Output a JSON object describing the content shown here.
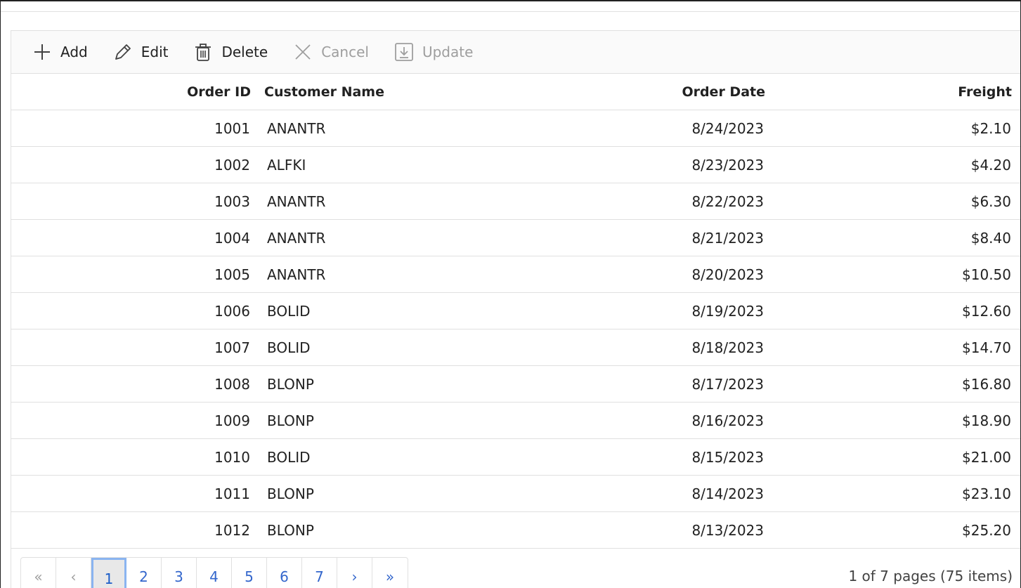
{
  "toolbar": {
    "add": "Add",
    "edit": "Edit",
    "delete": "Delete",
    "cancel": "Cancel",
    "update": "Update"
  },
  "columns": {
    "order_id": "Order ID",
    "customer_name": "Customer Name",
    "order_date": "Order Date",
    "freight": "Freight"
  },
  "rows": [
    {
      "order_id": "1001",
      "customer_name": "ANANTR",
      "order_date": "8/24/2023",
      "freight": "$2.10"
    },
    {
      "order_id": "1002",
      "customer_name": "ALFKI",
      "order_date": "8/23/2023",
      "freight": "$4.20"
    },
    {
      "order_id": "1003",
      "customer_name": "ANANTR",
      "order_date": "8/22/2023",
      "freight": "$6.30"
    },
    {
      "order_id": "1004",
      "customer_name": "ANANTR",
      "order_date": "8/21/2023",
      "freight": "$8.40"
    },
    {
      "order_id": "1005",
      "customer_name": "ANANTR",
      "order_date": "8/20/2023",
      "freight": "$10.50"
    },
    {
      "order_id": "1006",
      "customer_name": "BOLID",
      "order_date": "8/19/2023",
      "freight": "$12.60"
    },
    {
      "order_id": "1007",
      "customer_name": "BOLID",
      "order_date": "8/18/2023",
      "freight": "$14.70"
    },
    {
      "order_id": "1008",
      "customer_name": "BLONP",
      "order_date": "8/17/2023",
      "freight": "$16.80"
    },
    {
      "order_id": "1009",
      "customer_name": "BLONP",
      "order_date": "8/16/2023",
      "freight": "$18.90"
    },
    {
      "order_id": "1010",
      "customer_name": "BOLID",
      "order_date": "8/15/2023",
      "freight": "$21.00"
    },
    {
      "order_id": "1011",
      "customer_name": "BLONP",
      "order_date": "8/14/2023",
      "freight": "$23.10"
    },
    {
      "order_id": "1012",
      "customer_name": "BLONP",
      "order_date": "8/13/2023",
      "freight": "$25.20"
    }
  ],
  "pager": {
    "first": "«",
    "prev": "‹",
    "pages": [
      "1",
      "2",
      "3",
      "4",
      "5",
      "6",
      "7"
    ],
    "current_page": "1",
    "next": "›",
    "last": "»",
    "info": "1 of 7 pages (75 items)"
  },
  "colors": {
    "link": "#3366cc",
    "disabled": "#9e9e9e",
    "border": "#e0e0e0"
  }
}
